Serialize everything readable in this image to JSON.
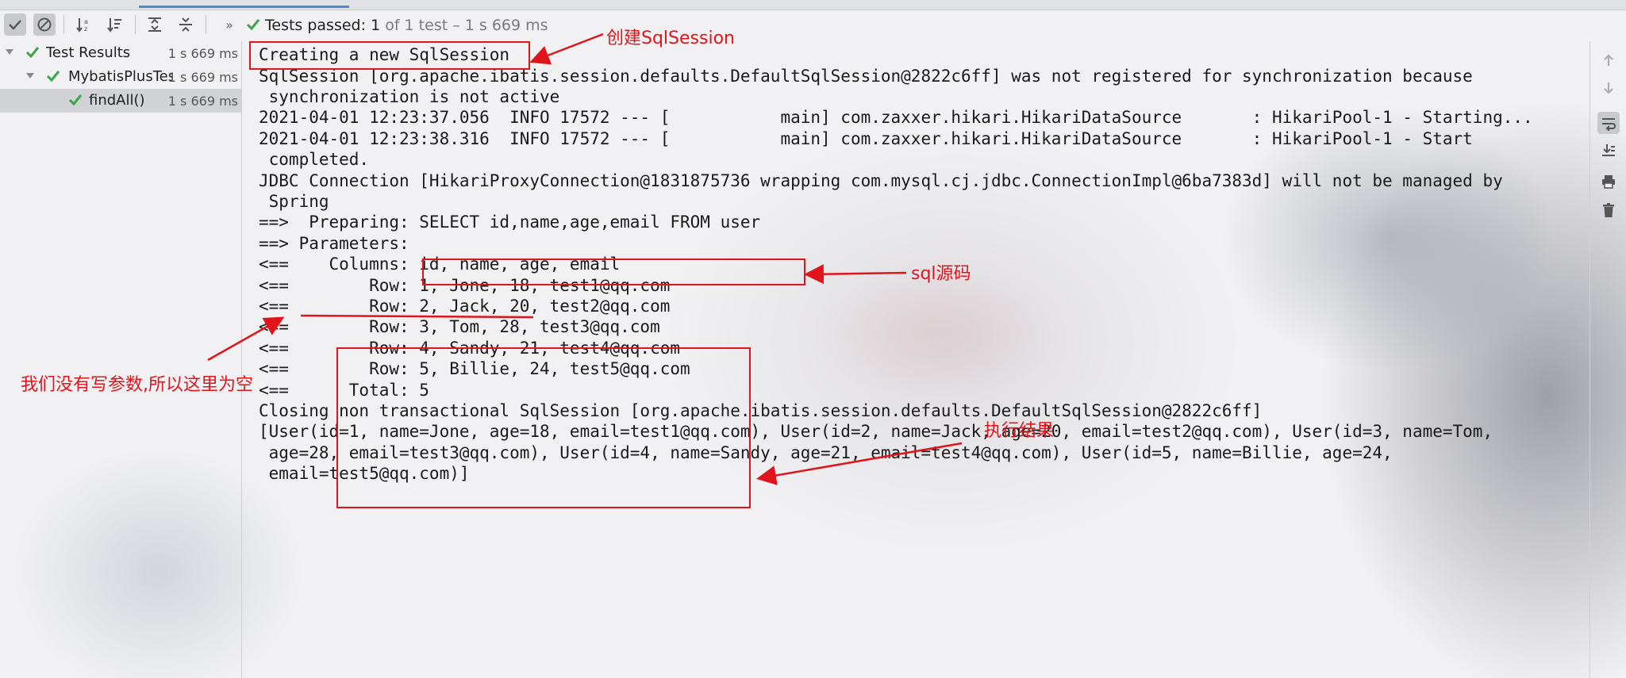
{
  "toolbar": {
    "status_prefix": "Tests passed:",
    "status_count": "1",
    "status_suffix": "of 1 test – 1 s 669 ms"
  },
  "tree": [
    {
      "label": "Test Results",
      "time": "1 s 669 ms"
    },
    {
      "label": "MybatisPlusTes",
      "time": "1 s 669 ms"
    },
    {
      "label": "findAll()",
      "time": "1 s 669 ms"
    }
  ],
  "console": {
    "lines": [
      "Creating a new SqlSession",
      "SqlSession [org.apache.ibatis.session.defaults.DefaultSqlSession@2822c6ff] was not registered for synchronization because",
      " synchronization is not active",
      "2021-04-01 12:23:37.056  INFO 17572 --- [           main] com.zaxxer.hikari.HikariDataSource       : HikariPool-1 - Starting...",
      "2021-04-01 12:23:38.316  INFO 17572 --- [           main] com.zaxxer.hikari.HikariDataSource       : HikariPool-1 - Start",
      " completed.",
      "JDBC Connection [HikariProxyConnection@1831875736 wrapping com.mysql.cj.jdbc.ConnectionImpl@6ba7383d] will not be managed by",
      " Spring",
      "==>  Preparing: SELECT id,name,age,email FROM user",
      "==> Parameters: ",
      "<==    Columns: id, name, age, email",
      "<==        Row: 1, Jone, 18, test1@qq.com",
      "<==        Row: 2, Jack, 20, test2@qq.com",
      "<==        Row: 3, Tom, 28, test3@qq.com",
      "<==        Row: 4, Sandy, 21, test4@qq.com",
      "<==        Row: 5, Billie, 24, test5@qq.com",
      "<==      Total: 5",
      "Closing non transactional SqlSession [org.apache.ibatis.session.defaults.DefaultSqlSession@2822c6ff]",
      "[User(id=1, name=Jone, age=18, email=test1@qq.com), User(id=2, name=Jack, age=20, email=test2@qq.com), User(id=3, name=Tom,",
      " age=28, email=test3@qq.com), User(id=4, name=Sandy, age=21, email=test4@qq.com), User(id=5, name=Billie, age=24,",
      " email=test5@qq.com)]"
    ]
  },
  "annotations": {
    "create_session": "创建SqlSession",
    "sql_source": "sql源码",
    "no_params": "我们没有写参数,所以这里为空",
    "result": "执行结果",
    "color": "#e0151b"
  },
  "colors": {
    "pass_green": "#3aa54a",
    "accent_blue": "#4a8cd8"
  }
}
